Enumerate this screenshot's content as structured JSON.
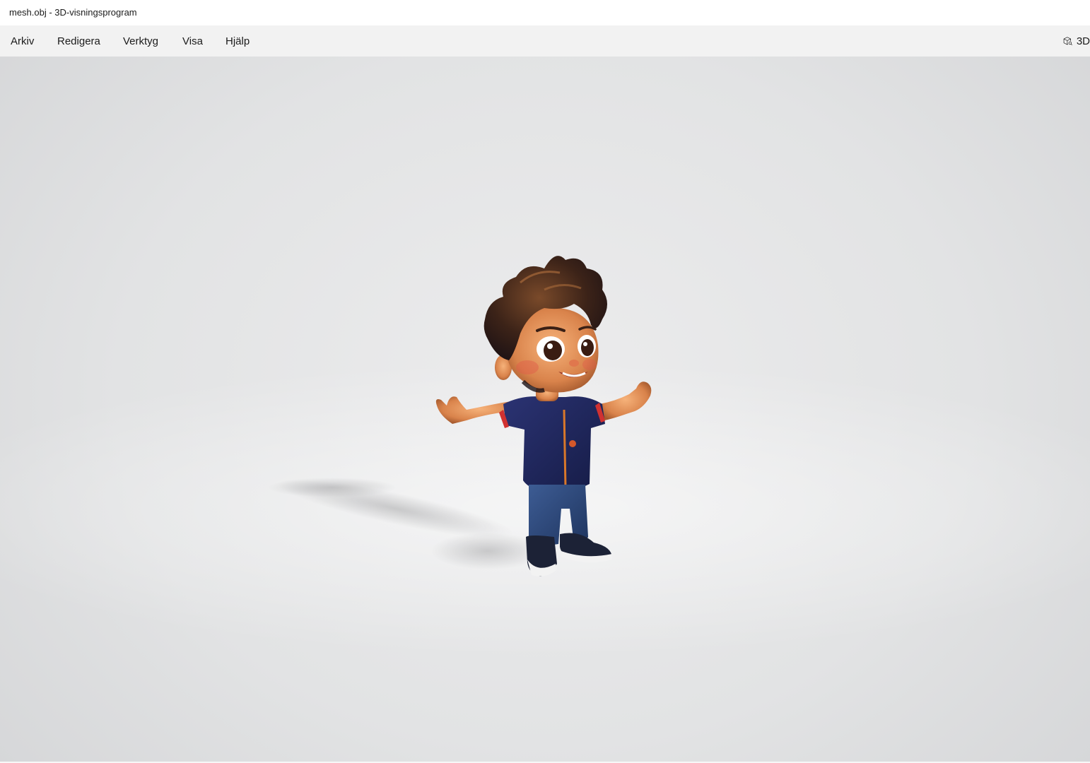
{
  "window": {
    "title": "mesh.obj - 3D-visningsprogram"
  },
  "menubar": {
    "items": [
      {
        "label": "Arkiv"
      },
      {
        "label": "Redigera"
      },
      {
        "label": "Verktyg"
      },
      {
        "label": "Visa"
      },
      {
        "label": "Hjälp"
      }
    ],
    "right_button": {
      "icon": "cube-icon",
      "label": "3D"
    }
  },
  "viewport": {
    "model_name": "mesh.obj",
    "background_color": "#e3e4e5"
  },
  "colors": {
    "titlebar": "#ffffff",
    "menubar": "#f2f2f2",
    "text": "#1b1b1b"
  }
}
